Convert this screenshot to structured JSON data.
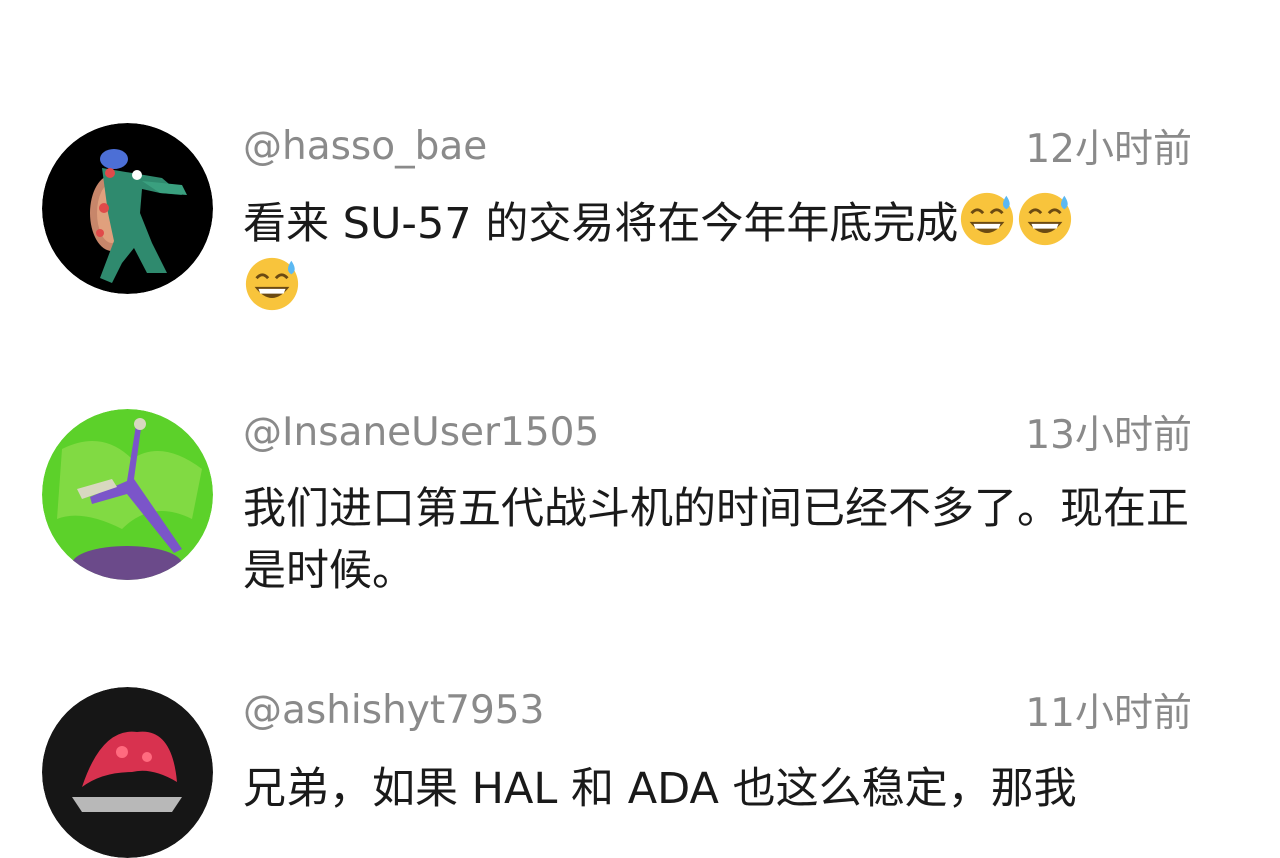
{
  "comments": [
    {
      "author": "@hasso_bae",
      "time": "12小时前",
      "text": "看来 SU-57 的交易将在今年年底完成",
      "emoji_icons": [
        "grinning-sweat-icon",
        "grinning-sweat-icon",
        "grinning-sweat-icon"
      ],
      "avatar_icon": "crocodile-avatar-icon"
    },
    {
      "author": "@InsaneUser1505",
      "time": "13小时前",
      "text": "我们进口第五代战斗机的时间已经不多了。现在正是时候。",
      "avatar_icon": "dancer-avatar-icon"
    },
    {
      "author": "@ashishyt7953",
      "time": "11小时前",
      "text": "兄弟，如果 HAL 和 ADA 也这么稳定，那我",
      "avatar_icon": "red-creature-avatar-icon"
    }
  ]
}
